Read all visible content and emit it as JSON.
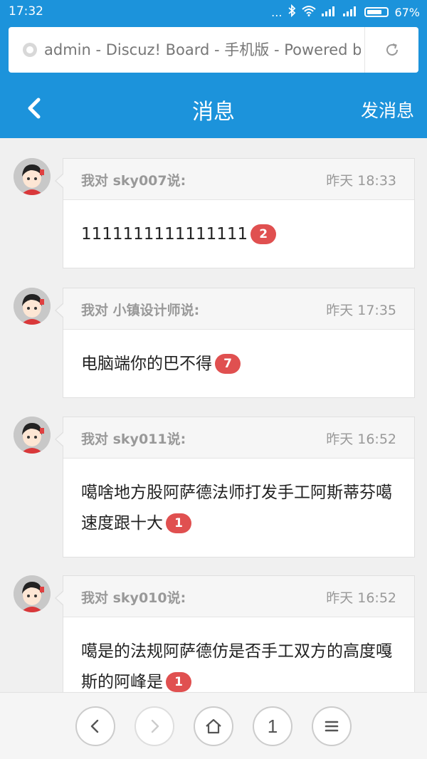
{
  "status_bar": {
    "time": "17:32",
    "dots": "...",
    "battery": "67%"
  },
  "browser": {
    "url_text": "admin - Discuz! Board - 手机版 - Powered by Discuz!"
  },
  "header": {
    "title": "消息",
    "send_label": "发消息"
  },
  "messages": [
    {
      "who": "我对 sky007说:",
      "when": "昨天 18:33",
      "text": "1111111111111111",
      "count": "2"
    },
    {
      "who": "我对 小镇设计师说:",
      "when": "昨天 17:35",
      "text": "电脑端你的巴不得",
      "count": "7"
    },
    {
      "who": "我对 sky011说:",
      "when": "昨天 16:52",
      "text": "噶啥地方股阿萨德法师打发手工阿斯蒂芬噶速度跟十大",
      "count": "1"
    },
    {
      "who": "我对 sky010说:",
      "when": "昨天 16:52",
      "text": "噶是的法规阿萨德仿是否手工双方的高度嘎斯的阿峰是",
      "count": "1"
    }
  ],
  "bottom_bar": {
    "tabs_count": "1"
  },
  "colors": {
    "accent": "#1c93db",
    "badge": "#e05050"
  }
}
